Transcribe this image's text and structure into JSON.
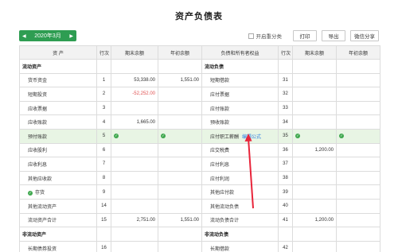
{
  "title": "资产负债表",
  "period": {
    "prev": "◀",
    "label": "2020年3月",
    "next": "▶"
  },
  "toolbar": {
    "checkbox_label": "开启重分类",
    "print": "打印",
    "export": "导出",
    "wechat": "微信分享"
  },
  "headers": [
    "资 产",
    "行次",
    "期末余额",
    "年初余额",
    "负债和所有者权益",
    "行次",
    "期末余额",
    "年初余额"
  ],
  "rows": [
    {
      "a": "流动资产",
      "an": "",
      "ae": "",
      "ab": "",
      "l": "流动负债",
      "ln": "",
      "le": "",
      "lb": "",
      "section": true
    },
    {
      "a": "货币资金",
      "an": "1",
      "ae": "53,338.00",
      "ab": "1,551.00",
      "l": "短期借款",
      "ln": "31",
      "le": "",
      "lb": ""
    },
    {
      "a": "短期投资",
      "an": "2",
      "ae": "-52,252.00",
      "ab": "",
      "l": "应付票据",
      "ln": "32",
      "le": "",
      "lb": "",
      "neg": true
    },
    {
      "a": "应收票据",
      "an": "3",
      "ae": "",
      "ab": "",
      "l": "应付账款",
      "ln": "33",
      "le": "",
      "lb": ""
    },
    {
      "a": "应收账款",
      "an": "4",
      "ae": "1,665.00",
      "ab": "",
      "l": "预收账款",
      "ln": "34",
      "le": "",
      "lb": ""
    },
    {
      "a": "预付账款",
      "an": "5",
      "ae": "",
      "ab": "",
      "l": "应付职工薪酬",
      "ln": "35",
      "le": "",
      "lb": "",
      "highlight": true
    },
    {
      "a": "应收股利",
      "an": "6",
      "ae": "",
      "ab": "",
      "l": "应交税费",
      "ln": "36",
      "le": "1,200.00",
      "lb": ""
    },
    {
      "a": "应收利息",
      "an": "7",
      "ae": "",
      "ab": "",
      "l": "应付利息",
      "ln": "37",
      "le": "",
      "lb": ""
    },
    {
      "a": "其他应收款",
      "an": "8",
      "ae": "",
      "ab": "",
      "l": "应付利润",
      "ln": "38",
      "le": "",
      "lb": ""
    },
    {
      "a": "存货",
      "an": "9",
      "ae": "",
      "ab": "",
      "l": "其他应付款",
      "ln": "39",
      "le": "",
      "lb": "",
      "adot": true
    },
    {
      "a": "其他流动资产",
      "an": "14",
      "ae": "",
      "ab": "",
      "l": "其他流动负债",
      "ln": "40",
      "le": "",
      "lb": ""
    },
    {
      "a": "流动资产合计",
      "an": "15",
      "ae": "2,751.00",
      "ab": "1,551.00",
      "l": "流动负债合计",
      "ln": "41",
      "le": "1,200.00",
      "lb": ""
    },
    {
      "a": "非流动资产",
      "an": "",
      "ae": "",
      "ab": "",
      "l": "非流动负债",
      "ln": "",
      "le": "",
      "lb": "",
      "section": true
    },
    {
      "a": "长期债券投资",
      "an": "16",
      "ae": "",
      "ab": "",
      "l": "长期借款",
      "ln": "42",
      "le": "",
      "lb": ""
    }
  ],
  "edit_formula_label": "编辑公式",
  "check_icon": "✓",
  "colors": {
    "accent": "#2e9d52",
    "highlight_row": "#e8f5e4",
    "negative": "#e05050",
    "link": "#2a7de1",
    "annotation": "#e8243a"
  }
}
